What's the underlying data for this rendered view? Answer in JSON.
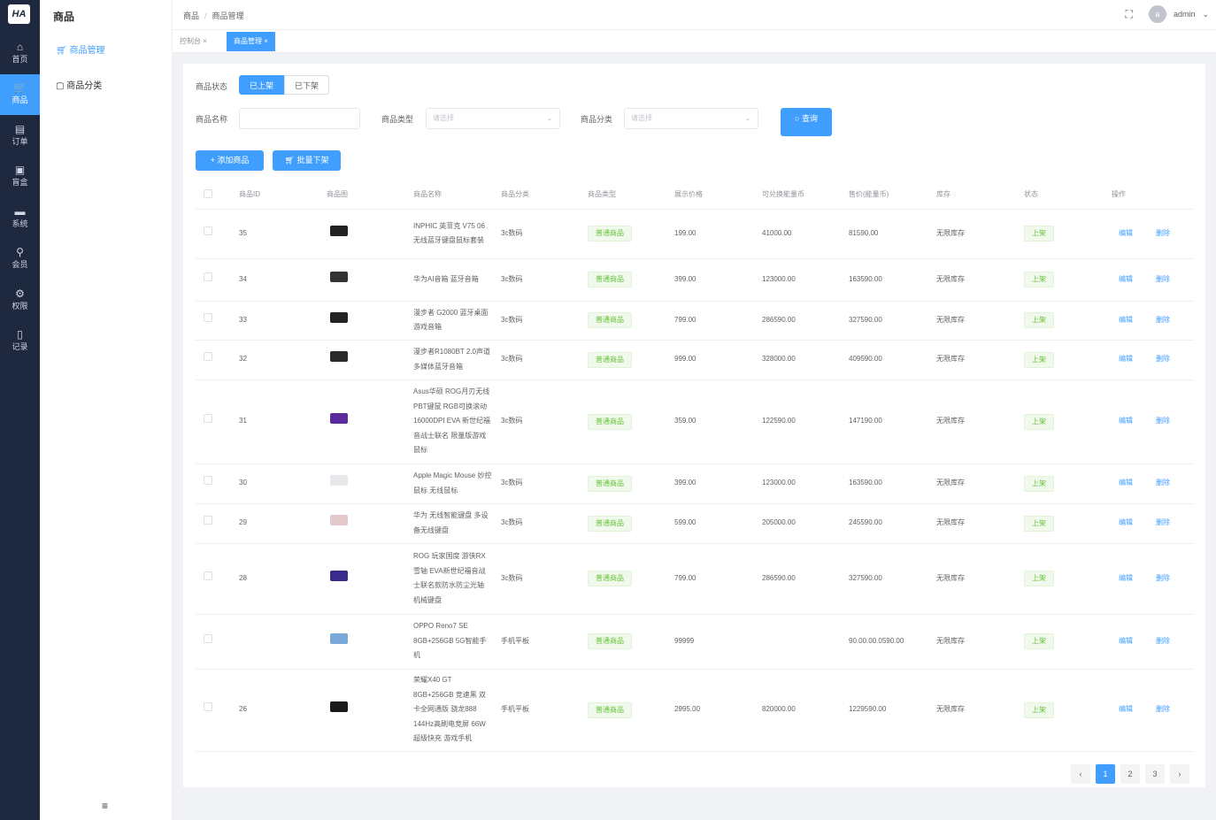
{
  "logo": "HA",
  "rail": [
    {
      "label": "首页",
      "icon": "⌂"
    },
    {
      "label": "商品",
      "icon": "🛒"
    },
    {
      "label": "订单",
      "icon": "▤"
    },
    {
      "label": "盲盒",
      "icon": "▣"
    },
    {
      "label": "系统",
      "icon": "▬"
    },
    {
      "label": "会员",
      "icon": "⚲"
    },
    {
      "label": "权限",
      "icon": "⚙"
    },
    {
      "label": "记录",
      "icon": "▯"
    }
  ],
  "submenu": {
    "title": "商品",
    "items": [
      "商品管理",
      "商品分类"
    ],
    "collapse": "≡"
  },
  "header": {
    "breadcrumb": [
      "商品",
      "商品管理"
    ],
    "user": "admin",
    "avatar": "a"
  },
  "tabs": [
    "控制台",
    "商品管理"
  ],
  "filters": {
    "status_label": "商品状态",
    "status_options": [
      "已上架",
      "已下架"
    ],
    "name_label": "商品名称",
    "name_value": "",
    "type_label": "商品类型",
    "type_placeholder": "请选择",
    "category_label": "商品分类",
    "category_placeholder": "请选择",
    "search_button": "查询"
  },
  "actions": {
    "add": "+ 添加商品",
    "batch_off": "批量下架"
  },
  "table": {
    "columns": [
      "商品ID",
      "商品图",
      "商品名称",
      "商品分类",
      "商品类型",
      "展示价格",
      "可兑换能量币",
      "售价(能量币)",
      "库存",
      "状态",
      "操作"
    ],
    "rows": [
      {
        "id": "35",
        "name": "INPHIC 英菲克 V75 06 无线蓝牙键盘鼠标套装",
        "cat": "3c数码",
        "type": "普通商品",
        "price": "199.00",
        "coin": "41000.00",
        "sale": "81590.00",
        "stock": "无限库存",
        "status": "上架",
        "img": "#222"
      },
      {
        "id": "34",
        "name": "华为AI音箱 蓝牙音箱",
        "cat": "3c数码",
        "type": "普通商品",
        "price": "399.00",
        "coin": "123000.00",
        "sale": "163590.00",
        "stock": "无限库存",
        "status": "上架",
        "img": "#333"
      },
      {
        "id": "33",
        "name": "漫步者 G2000 蓝牙桌面游戏音箱",
        "cat": "3c数码",
        "type": "普通商品",
        "price": "799.00",
        "coin": "286590.00",
        "sale": "327590.00",
        "stock": "无限库存",
        "status": "上架",
        "img": "#222"
      },
      {
        "id": "32",
        "name": "漫步者R1080BT 2.0声道多媒体蓝牙音箱",
        "cat": "3c数码",
        "type": "普通商品",
        "price": "999.00",
        "coin": "328000.00",
        "sale": "409590.00",
        "stock": "无限库存",
        "status": "上架",
        "img": "#2a2a2a"
      },
      {
        "id": "31",
        "name": "Asus华硕 ROG月刃无线 PBT键鼠 RGB可换滚动 16000DPI EVA 新世纪福音战士联名 限量版游戏鼠标",
        "cat": "3c数码",
        "type": "普通商品",
        "price": "359.00",
        "coin": "122590.00",
        "sale": "147190.00",
        "stock": "无限库存",
        "status": "上架",
        "img": "#5b2a9c"
      },
      {
        "id": "30",
        "name": "Apple Magic Mouse 妙控鼠标 无线鼠标",
        "cat": "3c数码",
        "type": "普通商品",
        "price": "399.00",
        "coin": "123000.00",
        "sale": "163590.00",
        "stock": "无限库存",
        "status": "上架",
        "img": "#e8e8ec"
      },
      {
        "id": "29",
        "name": "华为 无线智能键盘 多设备无线键盘",
        "cat": "3c数码",
        "type": "普通商品",
        "price": "599.00",
        "coin": "205000.00",
        "sale": "245590.00",
        "stock": "无限库存",
        "status": "上架",
        "img": "#e3c8cc"
      },
      {
        "id": "28",
        "name": "ROG 玩家国度 游侠RX雪轴 EVA新世纪福音战士联名款防水防尘光轴 机械键盘",
        "cat": "3c数码",
        "type": "普通商品",
        "price": "799.00",
        "coin": "286590.00",
        "sale": "327590.00",
        "stock": "无限库存",
        "status": "上架",
        "img": "#3a2a8c"
      },
      {
        "id": "",
        "name": "OPPO Reno7 SE 8GB+256GB 5G智能手机",
        "cat": "手机平板",
        "type": "普通商品",
        "price": "99999",
        "coin": "",
        "sale": "90.00.00.0590.00",
        "stock": "无限库存",
        "status": "上架",
        "img": "#7aa8d8"
      },
      {
        "id": "26",
        "name": "荣耀X40 GT 8GB+256GB 竞速黑 双卡全网通版 骁龙888 144Hz高刷电竞屏 66W超级快充 游戏手机",
        "cat": "手机平板",
        "type": "普通商品",
        "price": "2995.00",
        "coin": "820000.00",
        "sale": "1229590.00",
        "stock": "无限库存",
        "status": "上架",
        "img": "#1a1a1a"
      }
    ],
    "edit": "编辑",
    "delete": "删除"
  },
  "pagination": {
    "prev": "‹",
    "pages": [
      "1",
      "2",
      "3"
    ],
    "next": "›",
    "current": "1"
  }
}
